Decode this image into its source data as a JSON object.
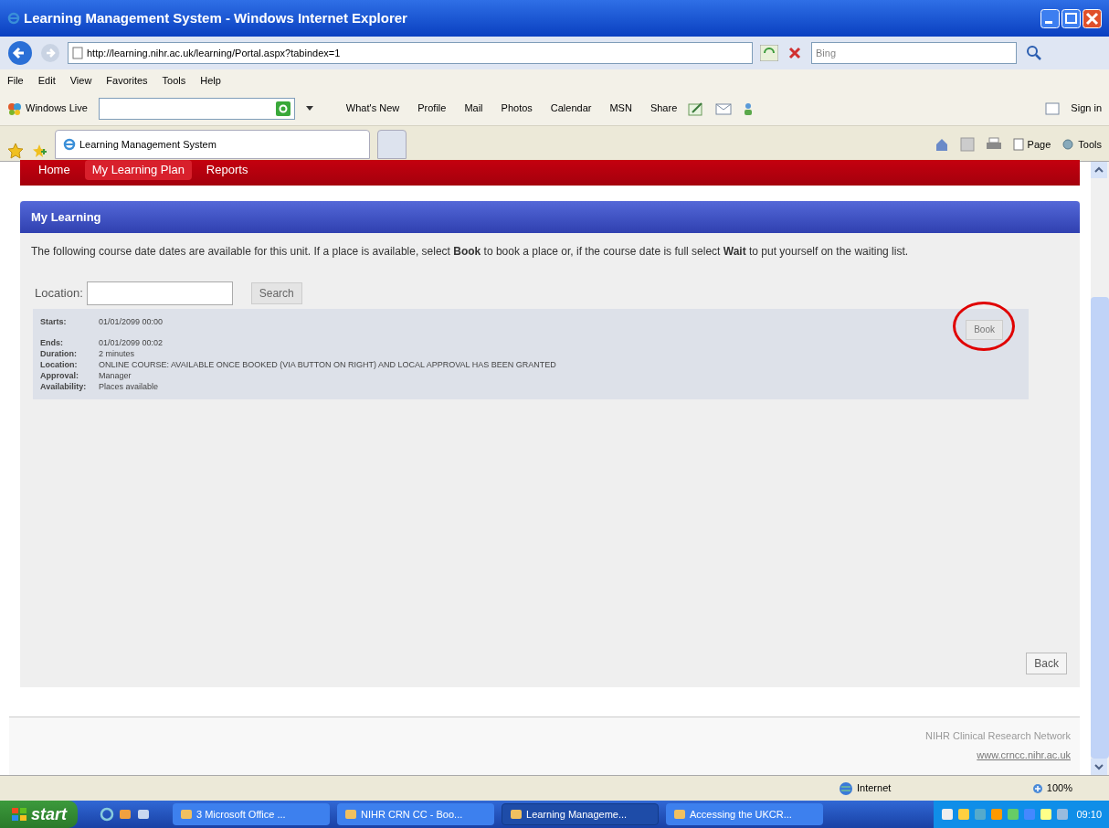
{
  "window": {
    "title": "Learning Management System - Windows Internet Explorer"
  },
  "address_bar": {
    "url": "http://learning.nihr.ac.uk/learning/Portal.aspx?tabindex=1",
    "search_placeholder": "Bing"
  },
  "menu_bar": [
    "File",
    "Edit",
    "View",
    "Favorites",
    "Tools",
    "Help"
  ],
  "live_toolbar": {
    "brand": "Windows Live",
    "links": [
      "What's New",
      "Profile",
      "Mail",
      "Photos",
      "Calendar",
      "MSN",
      "Share"
    ],
    "sign_in": "Sign in"
  },
  "tabs": [
    {
      "label": "Learning Management System",
      "selected": true
    }
  ],
  "command_bar": [
    "Page",
    "Tools"
  ],
  "site_nav": [
    {
      "label": "Home",
      "selected": false
    },
    {
      "label": "My Learning Plan",
      "selected": true
    },
    {
      "label": "Reports",
      "selected": false
    }
  ],
  "panel": {
    "title": "My Learning",
    "intro": "The following course date dates are available for this unit. If a place is available, select **Book** to book a place or, if the course date is full select **Wait** to put yourself on the waiting list.",
    "search": {
      "label": "Location:",
      "button": "Search"
    },
    "course": {
      "details": [
        {
          "label": "Starts:",
          "value": "01/01/2099 00:00"
        },
        {
          "label": "Ends:",
          "value": "01/01/2099 00:02"
        },
        {
          "label": "Duration:",
          "value": "2 minutes"
        },
        {
          "label": "Location:",
          "value": "ONLINE COURSE: AVAILABLE ONCE BOOKED (VIA BUTTON ON RIGHT) AND LOCAL APPROVAL HAS BEEN GRANTED"
        },
        {
          "label": "Approval:",
          "value": "Manager"
        },
        {
          "label": "Availability:",
          "value": "Places available"
        }
      ],
      "button": "Book",
      "highlighted": true
    },
    "back_button": "Back"
  },
  "footer": {
    "text": "NIHR Clinical Research Network",
    "link": "www.crncc.nihr.ac.uk"
  },
  "status_bar": {
    "zone": "Internet",
    "zoom": "100%"
  },
  "taskbar": {
    "start": "start",
    "items": [
      {
        "label": "3 Microsoft Office ...",
        "selected": false
      },
      {
        "label": "NIHR CRN CC - Boo...",
        "selected": false
      },
      {
        "label": "Learning Manageme...",
        "selected": true
      },
      {
        "label": "Accessing the UKCR...",
        "selected": false
      }
    ],
    "clock": "09:10"
  }
}
